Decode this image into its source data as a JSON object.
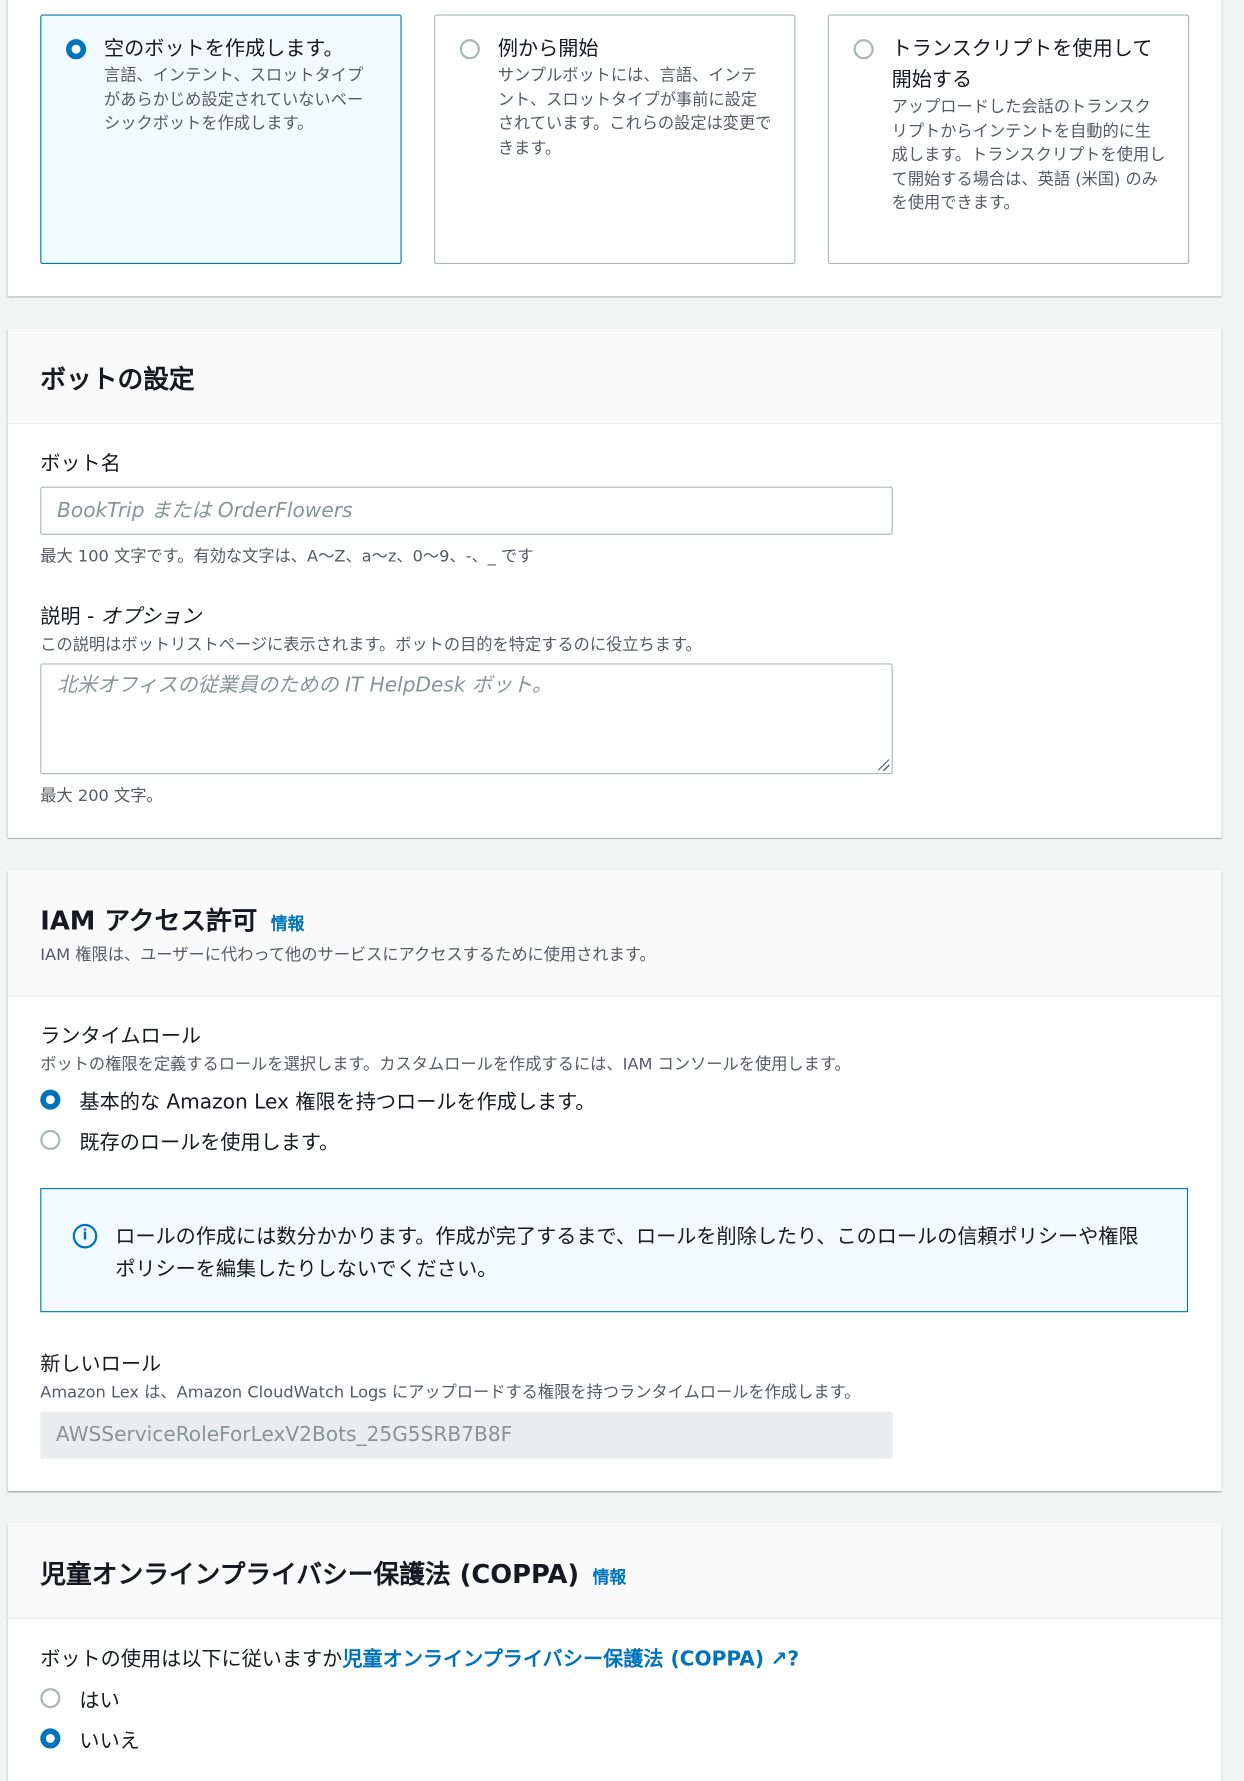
{
  "creation_method": {
    "options": [
      {
        "title": "空のボットを作成します。",
        "desc": "言語、インテント、スロットタイプがあらかじめ設定されていないベーシックボットを作成します。",
        "selected": true
      },
      {
        "title": "例から開始",
        "desc": "サンプルボットには、言語、インテント、スロットタイプが事前に設定されています。これらの設定は変更できます。",
        "selected": false
      },
      {
        "title": "トランスクリプトを使用して開始する",
        "desc": "アップロードした会話のトランスクリプトからインテントを自動的に生成します。トランスクリプトを使用して開始する場合は、英語 (米国) のみを使用できます。",
        "selected": false
      }
    ]
  },
  "bot_settings": {
    "title": "ボットの設定",
    "name_label": "ボット名",
    "name_placeholder": "BookTrip または OrderFlowers",
    "name_hint": "最大 100 文字です。有効な文字は、A〜Z、a〜z、0〜9、-、_ です",
    "desc_label": "説明 - ",
    "desc_label_optional": "オプション",
    "desc_sub": "この説明はボットリストページに表示されます。ボットの目的を特定するのに役立ちます。",
    "desc_placeholder": "北米オフィスの従業員のための IT HelpDesk ボット。",
    "desc_hint": "最大 200 文字。"
  },
  "iam": {
    "title": "IAM アクセス許可",
    "info": "情報",
    "subtitle": "IAM 権限は、ユーザーに代わって他のサービスにアクセスするために使用されます。",
    "runtime_label": "ランタイムロール",
    "runtime_sub": "ボットの権限を定義するロールを選択します。カスタムロールを作成するには、IAM コンソールを使用します。",
    "options": [
      {
        "label": "基本的な Amazon Lex 権限を持つロールを作成します。",
        "selected": true
      },
      {
        "label": "既存のロールを使用します。",
        "selected": false
      }
    ],
    "alert": "ロールの作成には数分かかります。作成が完了するまで、ロールを削除したり、このロールの信頼ポリシーや権限ポリシーを編集したりしないでください。",
    "new_role_label": "新しいロール",
    "new_role_sub": "Amazon Lex は、Amazon CloudWatch Logs にアップロードする権限を持つランタイムロールを作成します。",
    "new_role_value": "AWSServiceRoleForLexV2Bots_25G5SRB7B8F"
  },
  "coppa": {
    "title": "児童オンラインプライバシー保護法 (COPPA)",
    "info": "情報",
    "question_prefix": "ボットの使用は以下に従いますか",
    "question_link": "児童オンラインプライバシー保護法 (COPPA)",
    "question_suffix": "?",
    "options": [
      {
        "label": "はい",
        "selected": false
      },
      {
        "label": "いいえ",
        "selected": true
      }
    ]
  }
}
